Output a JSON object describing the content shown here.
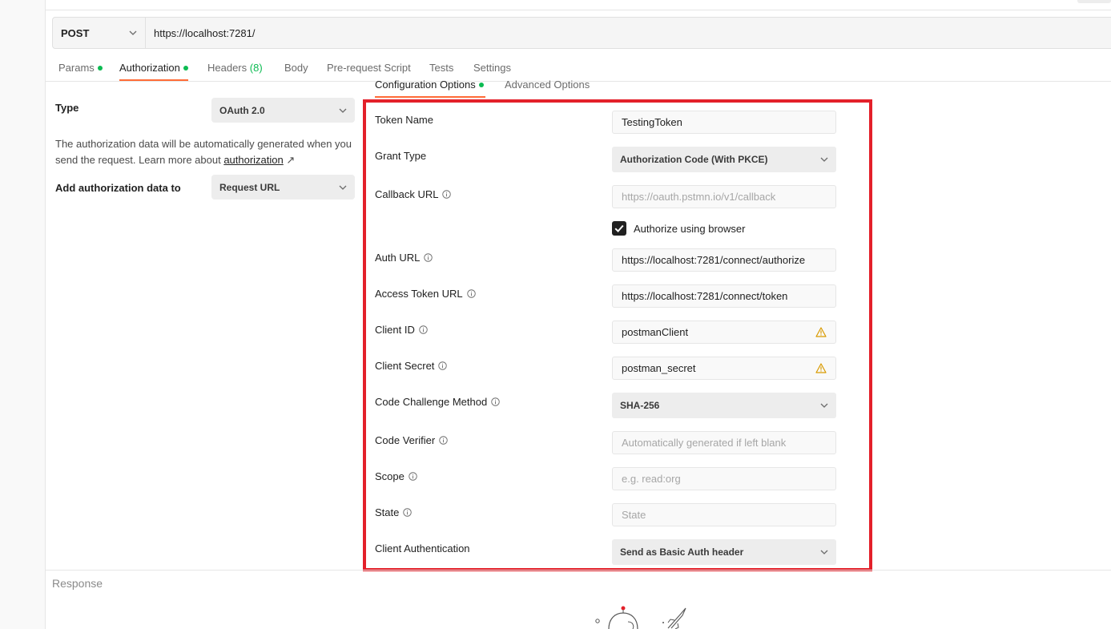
{
  "request": {
    "method": "POST",
    "url": "https://localhost:7281/"
  },
  "tabs": [
    {
      "label": "Params",
      "dot": true
    },
    {
      "label": "Authorization",
      "dot": true,
      "active": true
    },
    {
      "label": "Headers",
      "count": "(8)"
    },
    {
      "label": "Body"
    },
    {
      "label": "Pre-request Script"
    },
    {
      "label": "Tests"
    },
    {
      "label": "Settings"
    }
  ],
  "auth": {
    "type_label": "Type",
    "type_value": "OAuth 2.0",
    "description_part1": "The authorization data will be automatically generated when you send the request. Learn more about ",
    "description_link": "authorization",
    "description_arrow": "↗",
    "add_to_label": "Add authorization data to",
    "add_to_value": "Request URL"
  },
  "subtabs": [
    {
      "label": "Configuration Options",
      "dot": true,
      "active": true
    },
    {
      "label": "Advanced Options"
    }
  ],
  "config": {
    "token_name": {
      "label": "Token Name",
      "value": "TestingToken"
    },
    "grant_type": {
      "label": "Grant Type",
      "value": "Authorization Code (With PKCE)"
    },
    "callback_url": {
      "label": "Callback URL",
      "placeholder": "https://oauth.pstmn.io/v1/callback"
    },
    "authorize_browser": {
      "label": "Authorize using browser",
      "checked": true
    },
    "auth_url": {
      "label": "Auth URL",
      "value": "https://localhost:7281/connect/authorize"
    },
    "access_token_url": {
      "label": "Access Token URL",
      "value": "https://localhost:7281/connect/token"
    },
    "client_id": {
      "label": "Client ID",
      "value": "postmanClient"
    },
    "client_secret": {
      "label": "Client Secret",
      "value": "postman_secret"
    },
    "code_challenge_method": {
      "label": "Code Challenge Method",
      "value": "SHA-256"
    },
    "code_verifier": {
      "label": "Code Verifier",
      "placeholder": "Automatically generated if left blank"
    },
    "scope": {
      "label": "Scope",
      "placeholder": "e.g. read:org"
    },
    "state": {
      "label": "State",
      "placeholder": "State"
    },
    "client_authentication": {
      "label": "Client Authentication",
      "value": "Send as Basic Auth header"
    }
  },
  "response": {
    "label": "Response"
  },
  "colors": {
    "accent": "#ff6c37",
    "status_dot": "#0cbb52",
    "highlight_border": "#e3202a",
    "warning": "#d99a00"
  }
}
